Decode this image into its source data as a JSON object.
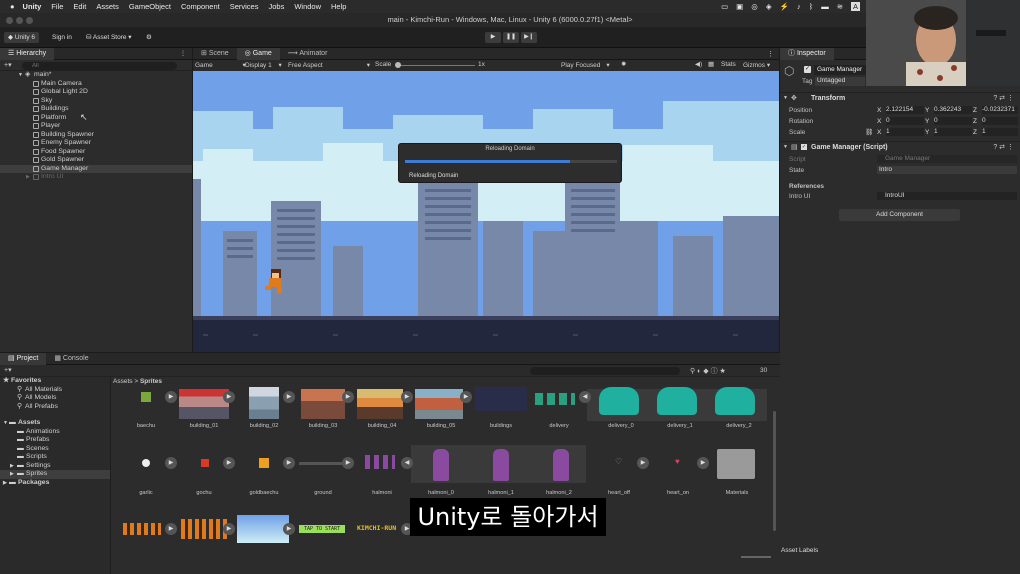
{
  "menubar": {
    "apple": "",
    "app": "Unity",
    "items": [
      "File",
      "Edit",
      "Assets",
      "GameObject",
      "Component",
      "Services",
      "Jobs",
      "Window",
      "Help"
    ]
  },
  "window": {
    "title": "main - Kimchi-Run - Windows, Mac, Linux - Unity 6 (6000.0.27f1) <Metal>"
  },
  "toolbar": {
    "account": "Unity 6",
    "sign_in": "Sign in",
    "asset_store": "Asset Store ▾"
  },
  "hierarchy": {
    "tab": "Hierarchy",
    "search_placeholder": "All",
    "scene": "main*",
    "items": [
      "Main Camera",
      "Global Light 2D",
      "Sky",
      "Buildings",
      "Platform",
      "Player",
      "Building Spawner",
      "Enemy Spawner",
      "Food Spawner",
      "Gold Spawner",
      "Game Manager",
      "Intro UI"
    ]
  },
  "scene_tabs": {
    "scene": "Scene",
    "game": "Game",
    "animator": "Animator"
  },
  "gamebar": {
    "mode": "Game",
    "display": "Display 1",
    "aspect": "Free Aspect",
    "scale_label": "Scale",
    "scale_value": "1x",
    "play_focused": "Play Focused",
    "stats": "Stats",
    "gizmos": "Gizmos"
  },
  "dialog": {
    "title": "Reloading Domain",
    "message": "Reloading Domain",
    "progress": 0.78
  },
  "inspector": {
    "tab": "Inspector",
    "object_name": "Game Manager",
    "tag_label": "Tag",
    "tag_value": "Untagged",
    "transform": {
      "header": "Transform",
      "position": {
        "label": "Position",
        "x": "2.122154",
        "y": "0.362243",
        "z": "-0.0232371"
      },
      "rotation": {
        "label": "Rotation",
        "x": "0",
        "y": "0",
        "z": "0"
      },
      "scale": {
        "label": "Scale",
        "x": "1",
        "y": "1",
        "z": "1"
      }
    },
    "script": {
      "header": "Game Manager (Script)",
      "script_label": "Script",
      "script_value": "Game Manager",
      "state_label": "State",
      "state_value": "Intro",
      "references": "References",
      "intro_label": "Intro UI",
      "intro_value": "IntroUI"
    },
    "add_component": "Add Component",
    "asset_labels": "Asset Labels"
  },
  "project": {
    "tabs": {
      "project": "Project",
      "console": "Console"
    },
    "breadcrumb": {
      "root": "Assets",
      "sep": ">",
      "current": "Sprites"
    },
    "count": "30",
    "favorites": {
      "header": "Favorites",
      "items": [
        "All Materials",
        "All Models",
        "All Prefabs"
      ]
    },
    "assets": {
      "header": "Assets",
      "items": [
        "Animations",
        "Prefabs",
        "Scenes",
        "Scripts",
        "Settings",
        "Sprites"
      ]
    },
    "packages": "Packages",
    "row1": [
      "baechu",
      "building_01",
      "building_02",
      "building_03",
      "building_04",
      "building_05",
      "buildings",
      "delivery",
      "delivery_0",
      "delivery_1",
      "delivery_2"
    ],
    "row2": [
      "garlic",
      "gochu",
      "goldbaechu",
      "ground",
      "halmoni",
      "halmoni_0",
      "halmoni_1",
      "halmoni_2",
      "heart_off",
      "heart_on",
      "Materials"
    ],
    "row3_texts": [
      "TAP TO START",
      "KIMCHI-RUN"
    ]
  },
  "subtitle": "Unity로 돌아가서",
  "colors": {
    "sky": "#6fa0e8",
    "cloud": "#bfe3ef",
    "building_back": "#7585a6",
    "building_front": "#4a5a7c",
    "ground": "#23273d",
    "progress": "#3d7bd4",
    "accent": "#4c8fe0"
  }
}
